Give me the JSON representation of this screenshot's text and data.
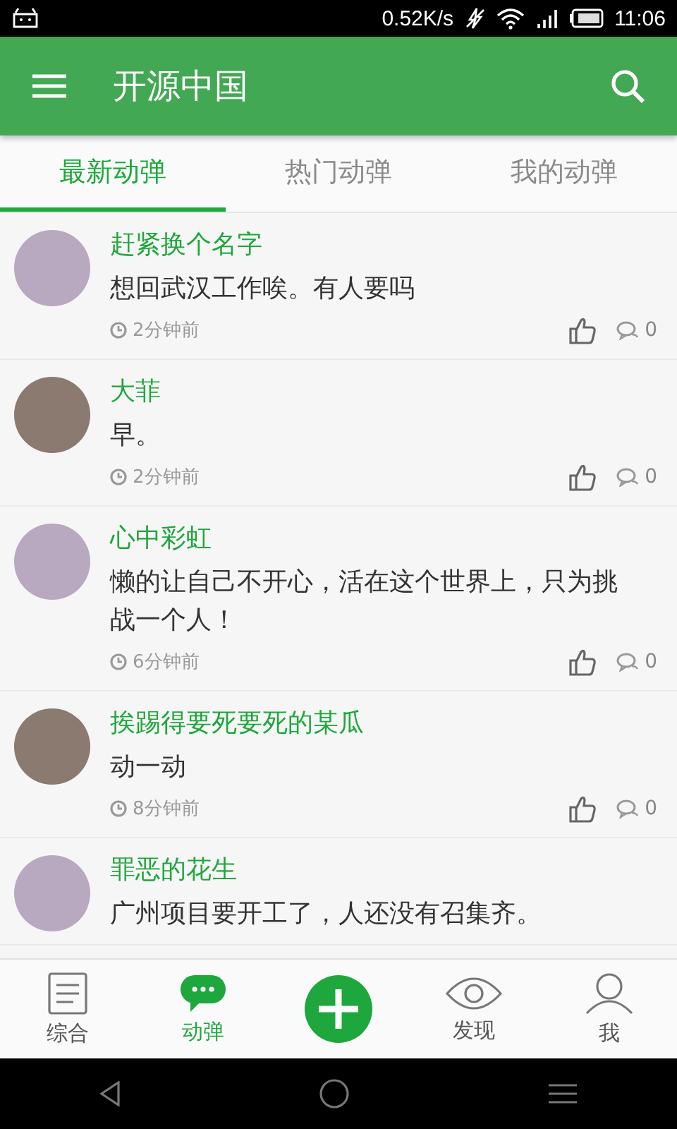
{
  "status_bar": {
    "speed": "0.52K/s",
    "time": "11:06"
  },
  "header": {
    "title": "开源中国"
  },
  "tabs": [
    {
      "label": "最新动弹",
      "selected": true
    },
    {
      "label": "热门动弹",
      "selected": false
    },
    {
      "label": "我的动弹",
      "selected": false
    }
  ],
  "posts": [
    {
      "author": "赶紧换个名字",
      "text": "想回武汉工作唉。有人要吗",
      "time": "2分钟前",
      "comments": "0"
    },
    {
      "author": "大菲",
      "text": "早。",
      "time": "2分钟前",
      "comments": "0"
    },
    {
      "author": "心中彩虹",
      "text": "懒的让自己不开心，活在这个世界上，只为挑战一个人！",
      "time": "6分钟前",
      "comments": "0"
    },
    {
      "author": "挨踢得要死要死的某瓜",
      "text": "动一动",
      "time": "8分钟前",
      "comments": "0"
    },
    {
      "author": "罪恶的花生",
      "text": "广州项目要开工了，人还没有召集齐。"
    }
  ],
  "bottom_nav": [
    {
      "kind": "doc",
      "label": "综合",
      "selected": false
    },
    {
      "kind": "chat",
      "label": "动弹",
      "selected": true
    },
    {
      "kind": "add"
    },
    {
      "kind": "eye",
      "label": "发现",
      "selected": false
    },
    {
      "kind": "person",
      "label": "我",
      "selected": false
    }
  ]
}
